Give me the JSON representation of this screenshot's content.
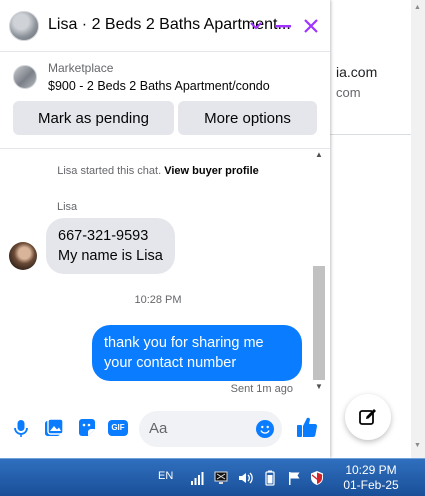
{
  "background": {
    "email_fragment": "ia.com",
    "email_fragment_2": "com"
  },
  "chat": {
    "header_title": "Lisa · 2 Beds 2 Baths Apartment...",
    "listing": {
      "category": "Marketplace",
      "title": "$900 - 2 Beds 2 Baths Apartment/condo"
    },
    "buttons": {
      "mark_pending": "Mark as pending",
      "more_options": "More options"
    },
    "system_message": {
      "prefix": "Lisa started this chat.",
      "link": "View buyer profile"
    },
    "sender_name": "Lisa",
    "incoming_lines": [
      "667-321-9593",
      "My name is Lisa"
    ],
    "time_separator": "10:28 PM",
    "outgoing_message": "thank you for sharing me your contact number",
    "sent_status": "Sent 1m ago",
    "composer_placeholder": "Aa",
    "gif_label": "GIF"
  },
  "taskbar": {
    "language": "EN",
    "time": "10:29 PM",
    "date": "01-Feb-25"
  },
  "colors": {
    "accent": "#a033ff",
    "messenger_blue": "#0a7cff",
    "bubble_grey": "#e4e6eb",
    "taskbar_blue": "#1a4f98"
  }
}
